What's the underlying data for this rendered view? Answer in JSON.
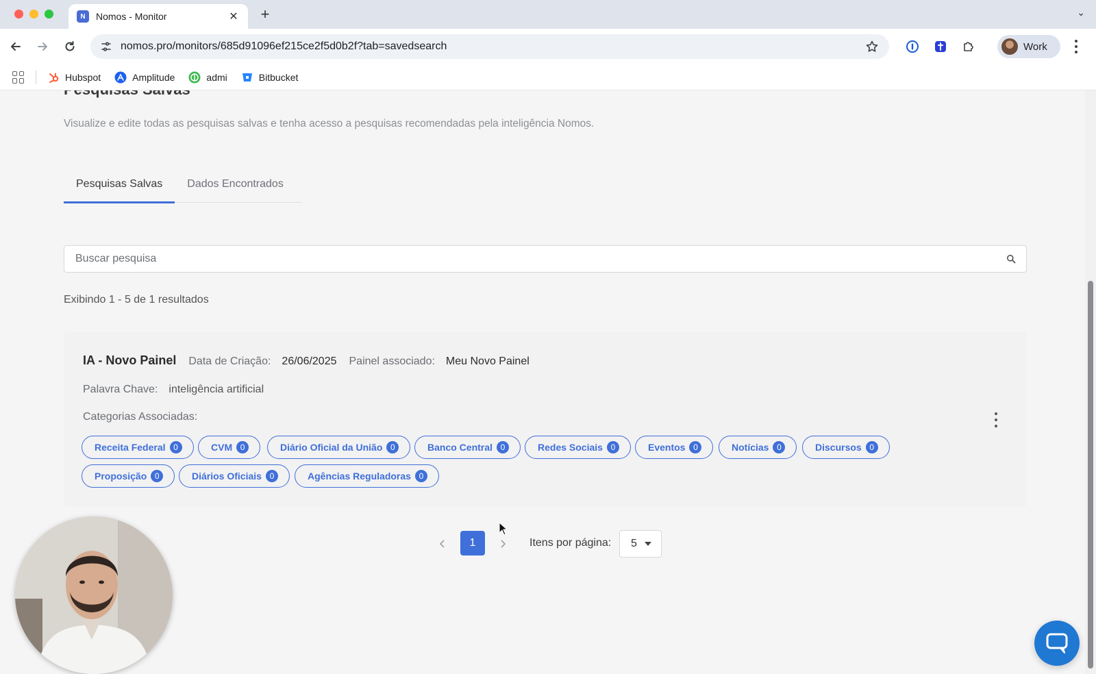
{
  "browser": {
    "tab_title": "Nomos - Monitor",
    "tab_favicon": "N",
    "url": "nomos.pro/monitors/685d91096ef215ce2f5d0b2f?tab=savedsearch",
    "profile_label": "Work",
    "bookmarks": [
      {
        "label": "Hubspot",
        "icon": "hubspot-icon"
      },
      {
        "label": "Amplitude",
        "icon": "amplitude-icon"
      },
      {
        "label": "admi",
        "icon": "admi-icon"
      },
      {
        "label": "Bitbucket",
        "icon": "bitbucket-icon"
      }
    ]
  },
  "page": {
    "title": "Pesquisas Salvas",
    "description": "Visualize e edite todas as pesquisas salvas e tenha acesso a pesquisas recomendadas pela inteligência Nomos.",
    "tabs": [
      {
        "label": "Pesquisas Salvas",
        "active": true
      },
      {
        "label": "Dados Encontrados",
        "active": false
      }
    ],
    "search_placeholder": "Buscar pesquisa",
    "results_count": "Exibindo 1 - 5 de 1 resultados"
  },
  "saved_search": {
    "name": "IA - Novo Painel",
    "creation_label": "Data de Criação:",
    "creation_date": "26/06/2025",
    "panel_label": "Painel associado:",
    "panel_value": "Meu Novo Painel",
    "keyword_label": "Palavra Chave:",
    "keyword_value": "inteligência artificial",
    "categories_label": "Categorias Associadas:",
    "categories": [
      {
        "label": "Receita Federal",
        "count": "0"
      },
      {
        "label": "CVM",
        "count": "0"
      },
      {
        "label": "Diário Oficial da União",
        "count": "0"
      },
      {
        "label": "Banco Central",
        "count": "0"
      },
      {
        "label": "Redes Sociais",
        "count": "0"
      },
      {
        "label": "Eventos",
        "count": "0"
      },
      {
        "label": "Notícias",
        "count": "0"
      },
      {
        "label": "Discursos",
        "count": "0"
      },
      {
        "label": "Proposição",
        "count": "0"
      },
      {
        "label": "Diários Oficiais",
        "count": "0"
      },
      {
        "label": "Agências Reguladoras",
        "count": "0"
      }
    ]
  },
  "pagination": {
    "current_page": "1",
    "per_page_label": "Itens por página:",
    "per_page_value": "5"
  },
  "colors": {
    "accent": "#3f6fd8",
    "chat_button": "#1f78d1"
  }
}
